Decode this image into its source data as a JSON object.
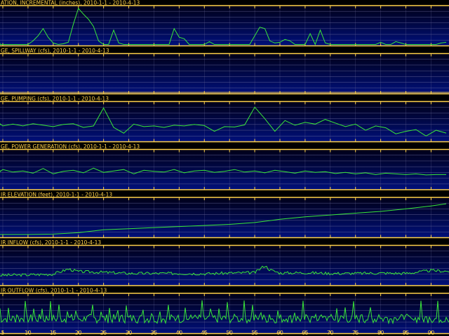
{
  "colors": {
    "background": "#000000",
    "panel_top": "#000018",
    "panel_bottom": "#00107a",
    "frame": "#ffd24a",
    "grid": "#6a6a9a",
    "series": "#39e639",
    "text": "#ffd24a"
  },
  "chart_data": [
    {
      "type": "line",
      "title": "ATION, INCREMENTAL (inches), 2010-1-1 - 2010-4-13",
      "grid": true,
      "x": [
        1,
        2,
        3,
        4,
        5,
        6,
        7,
        8,
        9,
        10,
        11,
        12,
        13,
        14,
        15,
        16,
        17,
        18,
        19,
        20,
        21,
        22,
        23,
        24,
        25,
        26,
        27,
        28,
        29,
        30,
        31,
        32,
        33,
        34,
        35,
        36,
        37,
        38,
        39,
        40,
        41,
        42,
        43,
        44,
        45,
        46,
        47,
        48,
        49,
        50,
        51,
        52,
        53,
        54,
        55,
        56,
        57,
        58,
        59,
        60,
        61,
        62,
        63,
        64,
        65,
        66,
        67,
        68,
        69,
        70,
        71,
        72,
        73,
        74,
        75,
        76,
        77,
        78,
        79,
        80,
        81,
        82,
        83,
        84,
        85,
        86,
        87,
        88,
        89,
        90,
        91,
        92,
        93
      ],
      "y": [
        0.02,
        0,
        0,
        0,
        0,
        0,
        0,
        0,
        0,
        0,
        0.05,
        0.12,
        0.22,
        0.1,
        0.02,
        0,
        0.01,
        0.03,
        0.28,
        0.5,
        0.42,
        0.35,
        0.25,
        0.05,
        0,
        0,
        0.2,
        0.02,
        0,
        0,
        0,
        0,
        0,
        0,
        0,
        0,
        0,
        0,
        0.22,
        0.1,
        0.08,
        0,
        0,
        0,
        0,
        0.04,
        0,
        0,
        0,
        0,
        0,
        0,
        0,
        0,
        0.12,
        0.24,
        0.22,
        0.05,
        0.02,
        0.03,
        0.07,
        0.05,
        0,
        0,
        0,
        0.15,
        0,
        0.2,
        0.02,
        0,
        0,
        0,
        0,
        0,
        0,
        0,
        0,
        0,
        0,
        0.03,
        0,
        0,
        0.04,
        0.02,
        0,
        0,
        0,
        0,
        0,
        0,
        0,
        0.02,
        0.03
      ],
      "ylim": [
        0,
        0.5
      ]
    },
    {
      "type": "line",
      "title": "GE, SPILLWAY (cfs), 2010-1-1 - 2010-4-13",
      "grid": true,
      "x": [
        1,
        93
      ],
      "y": [
        0,
        0
      ],
      "ylim": [
        0,
        1
      ]
    },
    {
      "type": "line",
      "title": "GE, PUMPING (cfs), 2010-1-1 - 2010-4-13",
      "grid": true,
      "x": [
        1,
        3,
        5,
        7,
        9,
        11,
        13,
        15,
        17,
        19,
        21,
        23,
        25,
        27,
        29,
        31,
        33,
        35,
        37,
        39,
        41,
        43,
        45,
        47,
        49,
        51,
        53,
        55,
        57,
        59,
        61,
        63,
        65,
        67,
        69,
        71,
        73,
        75,
        77,
        79,
        81,
        83,
        85,
        87,
        89,
        91,
        93
      ],
      "y": [
        0.42,
        0.46,
        0.4,
        0.45,
        0.4,
        0.46,
        0.42,
        0.38,
        0.44,
        0.46,
        0.36,
        0.4,
        0.9,
        0.36,
        0.2,
        0.45,
        0.38,
        0.4,
        0.36,
        0.42,
        0.4,
        0.44,
        0.41,
        0.25,
        0.38,
        0.37,
        0.43,
        0.92,
        0.6,
        0.25,
        0.55,
        0.42,
        0.5,
        0.45,
        0.58,
        0.48,
        0.38,
        0.45,
        0.28,
        0.4,
        0.35,
        0.18,
        0.25,
        0.3,
        0.12,
        0.28,
        0.2
      ],
      "ylim": [
        0,
        1
      ]
    },
    {
      "type": "line",
      "title": "GE, POWER GENERATION (cfs), 2010-1-1 - 2010-4-13",
      "grid": true,
      "x": [
        1,
        3,
        5,
        7,
        9,
        11,
        13,
        15,
        17,
        19,
        21,
        23,
        25,
        27,
        29,
        31,
        33,
        35,
        37,
        39,
        41,
        43,
        45,
        47,
        49,
        51,
        53,
        55,
        57,
        59,
        61,
        63,
        65,
        67,
        69,
        71,
        73,
        75,
        77,
        79,
        81,
        83,
        85,
        87,
        89,
        91,
        93
      ],
      "y": [
        0.5,
        0.46,
        0.52,
        0.45,
        0.48,
        0.42,
        0.55,
        0.4,
        0.47,
        0.5,
        0.43,
        0.56,
        0.44,
        0.48,
        0.52,
        0.4,
        0.5,
        0.47,
        0.45,
        0.52,
        0.43,
        0.48,
        0.5,
        0.44,
        0.47,
        0.52,
        0.45,
        0.48,
        0.43,
        0.5,
        0.46,
        0.42,
        0.48,
        0.44,
        0.46,
        0.41,
        0.44,
        0.4,
        0.43,
        0.38,
        0.42,
        0.4,
        0.38,
        0.4,
        0.37,
        0.38,
        0.38
      ],
      "ylim": [
        0,
        1
      ]
    },
    {
      "type": "line",
      "title": "IR ELEVATION (feet), 2010-1-1 - 2010-4-13",
      "grid": true,
      "x": [
        1,
        10,
        15,
        20,
        25,
        30,
        35,
        40,
        45,
        50,
        55,
        60,
        65,
        70,
        75,
        80,
        85,
        90,
        93
      ],
      "y": [
        0.05,
        0.05,
        0.06,
        0.1,
        0.18,
        0.21,
        0.24,
        0.27,
        0.3,
        0.33,
        0.38,
        0.47,
        0.54,
        0.59,
        0.64,
        0.69,
        0.76,
        0.84,
        0.9
      ],
      "ylim": [
        0,
        1
      ]
    },
    {
      "type": "line",
      "title": "IR INFLOW (cfs), 2010-1-1 - 2010-4-13",
      "grid": true,
      "x": [
        1,
        5,
        10,
        15,
        18,
        20,
        25,
        30,
        35,
        40,
        45,
        50,
        55,
        57,
        58,
        60,
        65,
        70,
        75,
        80,
        85,
        90,
        93
      ],
      "y": [
        0.22,
        0.25,
        0.26,
        0.28,
        0.42,
        0.35,
        0.33,
        0.3,
        0.3,
        0.3,
        0.29,
        0.31,
        0.32,
        0.52,
        0.4,
        0.31,
        0.32,
        0.3,
        0.3,
        0.31,
        0.3,
        0.38,
        0.36
      ],
      "ylim": [
        0,
        1
      ]
    },
    {
      "type": "line",
      "title": "IR OUTFLOW (cfs), 2010-1-1 - 2010-4-13",
      "grid": true,
      "x": [
        1,
        93
      ],
      "y": [
        0.4,
        0.4
      ],
      "ylim": [
        0,
        1
      ]
    }
  ],
  "xaxis": {
    "ticks": [
      "5",
      "10",
      "15",
      "20",
      "25",
      "30",
      "35",
      "40",
      "45",
      "50",
      "55",
      "60",
      "65",
      "70",
      "75",
      "80",
      "85",
      "90"
    ],
    "tick_values": [
      5,
      10,
      15,
      20,
      25,
      30,
      35,
      40,
      45,
      50,
      55,
      60,
      65,
      70,
      75,
      80,
      85,
      90
    ],
    "xlim": [
      5,
      93
    ]
  }
}
